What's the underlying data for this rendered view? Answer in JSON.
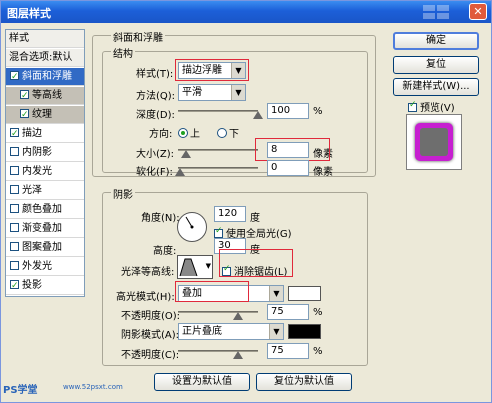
{
  "window": {
    "title": "图层样式",
    "close_glyph": "✕"
  },
  "style_list": {
    "items": [
      {
        "label": "样式",
        "kind": "head",
        "checked": false
      },
      {
        "label": "混合选项:默认",
        "kind": "head",
        "checked": false
      },
      {
        "label": "斜面和浮雕",
        "kind": "selected",
        "checked": true
      },
      {
        "label": "等高线",
        "kind": "sub",
        "checked": true
      },
      {
        "label": "纹理",
        "kind": "sub",
        "checked": true
      },
      {
        "label": "描边",
        "kind": "normal",
        "checked": true
      },
      {
        "label": "内阴影",
        "kind": "normal",
        "checked": false
      },
      {
        "label": "内发光",
        "kind": "normal",
        "checked": false
      },
      {
        "label": "光泽",
        "kind": "normal",
        "checked": false
      },
      {
        "label": "颜色叠加",
        "kind": "normal",
        "checked": false
      },
      {
        "label": "渐变叠加",
        "kind": "normal",
        "checked": false
      },
      {
        "label": "图案叠加",
        "kind": "normal",
        "checked": false
      },
      {
        "label": "外发光",
        "kind": "normal",
        "checked": false
      },
      {
        "label": "投影",
        "kind": "normal",
        "checked": true
      }
    ]
  },
  "bevel": {
    "group_title": "斜面和浮雕",
    "structure_title": "结构",
    "style_label": "样式(T):",
    "style_value": "描边浮雕",
    "technique_label": "方法(Q):",
    "technique_value": "平滑",
    "depth_label": "深度(D):",
    "depth_value": "100",
    "depth_unit": "%",
    "depth_level": 1.0,
    "direction_label": "方向:",
    "direction_up": "上",
    "direction_down": "下",
    "size_label": "大小(Z):",
    "size_value": "8",
    "size_unit": "像素",
    "soften_label": "软化(F):",
    "soften_value": "0",
    "soften_unit": "像素"
  },
  "shading": {
    "title": "阴影",
    "angle_label": "角度(N):",
    "angle_value": "120",
    "angle_unit": "度",
    "global_light_label": "使用全局光(G)",
    "altitude_label": "高度:",
    "altitude_value": "30",
    "altitude_unit": "度",
    "gloss_contour_label": "光泽等高线:",
    "antialias_label": "消除锯齿(L)",
    "highlight_mode_label": "高光模式(H):",
    "highlight_mode_value": "叠加",
    "highlight_color": "#ffffff",
    "highlight_opacity_label": "不透明度(O):",
    "highlight_opacity_value": "75",
    "highlight_opacity_unit": "%",
    "shadow_mode_label": "阴影模式(A):",
    "shadow_mode_value": "正片叠底",
    "shadow_color": "#000000",
    "shadow_opacity_label": "不透明度(C):",
    "shadow_opacity_value": "75",
    "shadow_opacity_unit": "%"
  },
  "actions": {
    "ok": "确定",
    "reset": "复位",
    "new_style": "新建样式(W)...",
    "preview_label": "预览(V)"
  },
  "footer": {
    "make_default": "设置为默认值",
    "reset_default": "复位为默认值",
    "watermark_left": "PS学堂",
    "watermark_right": "www.52psxt.com"
  },
  "colors": {
    "accent": "#316ac5",
    "highlight_box": "#e0293b",
    "preview_magenta": "#c61fd0"
  }
}
